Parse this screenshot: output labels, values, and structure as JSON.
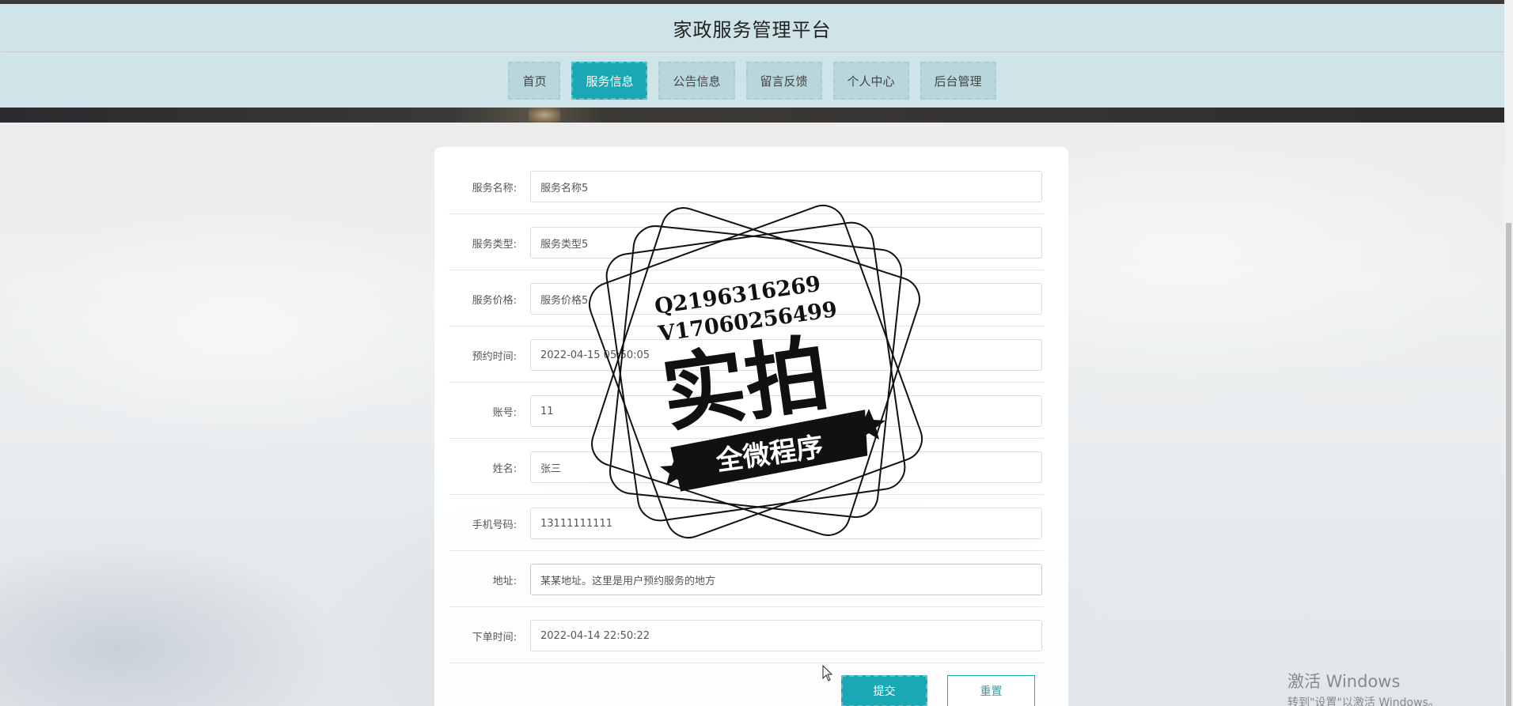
{
  "header": {
    "title": "家政服务管理平台"
  },
  "nav": {
    "items": [
      {
        "label": "首页",
        "active": false
      },
      {
        "label": "服务信息",
        "active": true
      },
      {
        "label": "公告信息",
        "active": false
      },
      {
        "label": "留言反馈",
        "active": false
      },
      {
        "label": "个人中心",
        "active": false
      },
      {
        "label": "后台管理",
        "active": false
      }
    ]
  },
  "form": {
    "fields": [
      {
        "label": "服务名称:",
        "value": "服务名称5"
      },
      {
        "label": "服务类型:",
        "value": "服务类型5"
      },
      {
        "label": "服务价格:",
        "value": "服务价格5"
      },
      {
        "label": "预约时间:",
        "value": "2022-04-15 05:50:05"
      },
      {
        "label": "账号:",
        "value": "11"
      },
      {
        "label": "姓名:",
        "value": "张三"
      },
      {
        "label": "手机号码:",
        "value": "13111111111"
      },
      {
        "label": "地址:",
        "value": "某某地址。这里是用户预约服务的地方"
      },
      {
        "label": "下单时间:",
        "value": "2022-04-14 22:50:22"
      }
    ],
    "submit_label": "提交",
    "reset_label": "重置"
  },
  "watermark": {
    "line1": "Q2196316269",
    "line2": "V17060256499",
    "main": "实拍",
    "ribbon": "全微程序"
  },
  "windows_activation": {
    "line1": "激活 Windows",
    "line2": "转到\"设置\"以激活 Windows。"
  },
  "colors": {
    "accent": "#1ba8b5",
    "header_bg": "#cfe4e8",
    "nav_item_bg": "#b8d7dc"
  }
}
